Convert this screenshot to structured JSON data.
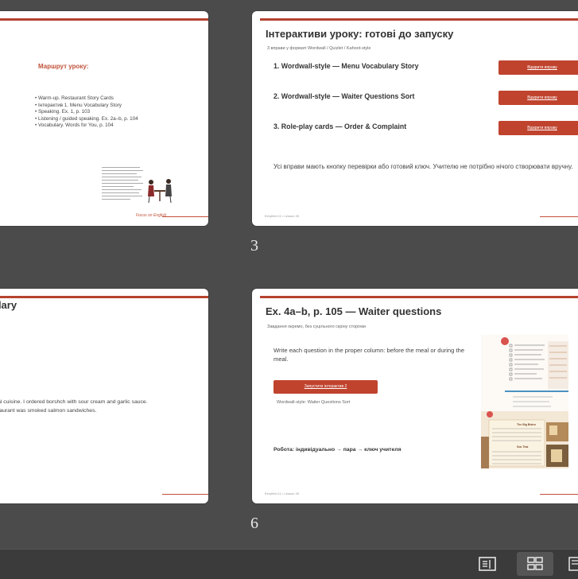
{
  "slides": {
    "s2": {
      "route_title": "Маршрут уроку:",
      "bullets": [
        "Warm-up. Restaurant Story Cards",
        "Інтерактив 1. Menu Vocabulary Story",
        "Speaking. Ex. 1, p. 103",
        "Listening / guided speaking. Ex. 2a–b, p. 104",
        "Vocabulary. Words for You, p. 104"
      ],
      "logo_text": "Focus on English"
    },
    "s3": {
      "number": "3",
      "title": "Інтерактиви уроку: готові до запуску",
      "subtitle": "3 вправи у форматі Wordwall / Quizlet / Kahoot-style",
      "exercises": [
        "1. Wordwall-style — Menu Vocabulary Story",
        "2. Wordwall-style — Waiter Questions Sort",
        "3. Role-play cards — Order & Complaint"
      ],
      "open_label": "Відкрити вправу",
      "note": "Усі вправи мають кнопку перевірки або готовий ключ. Учителю не потрібно нічого створювати вручну.",
      "footer": "Eeryfield 11 • Lesson 28"
    },
    "s5": {
      "title_part": "ulary",
      "line1": "ional cuisine. I ordered borshch with sour cream and garlic sauce.",
      "line2": "restaurant was smoked salmon sandwiches."
    },
    "s6": {
      "number": "6",
      "title": "Ex. 4a–b, p. 105 — Waiter questions",
      "subtitle": "Завдання окремо, без суцільного скріну сторінки",
      "task": "Write each question in the proper column: before the meal or during the meal.",
      "launch_label": "Запустити інтерактив 2",
      "caption": "Wordwall-style: Waiter Questions Sort",
      "work": "Робота: індивідуально → пара → ключ учителя",
      "footer": "Eeryfield 11 • Lesson 28",
      "book_heading1": "The Big Bistro",
      "book_heading2": "Sea Thai"
    }
  },
  "toolbar": {
    "buttons": [
      "reading-view-icon",
      "slide-sorter-icon",
      "normal-view-icon"
    ]
  },
  "colors": {
    "accent": "#c0432e",
    "stage": "#4b4b4b"
  }
}
